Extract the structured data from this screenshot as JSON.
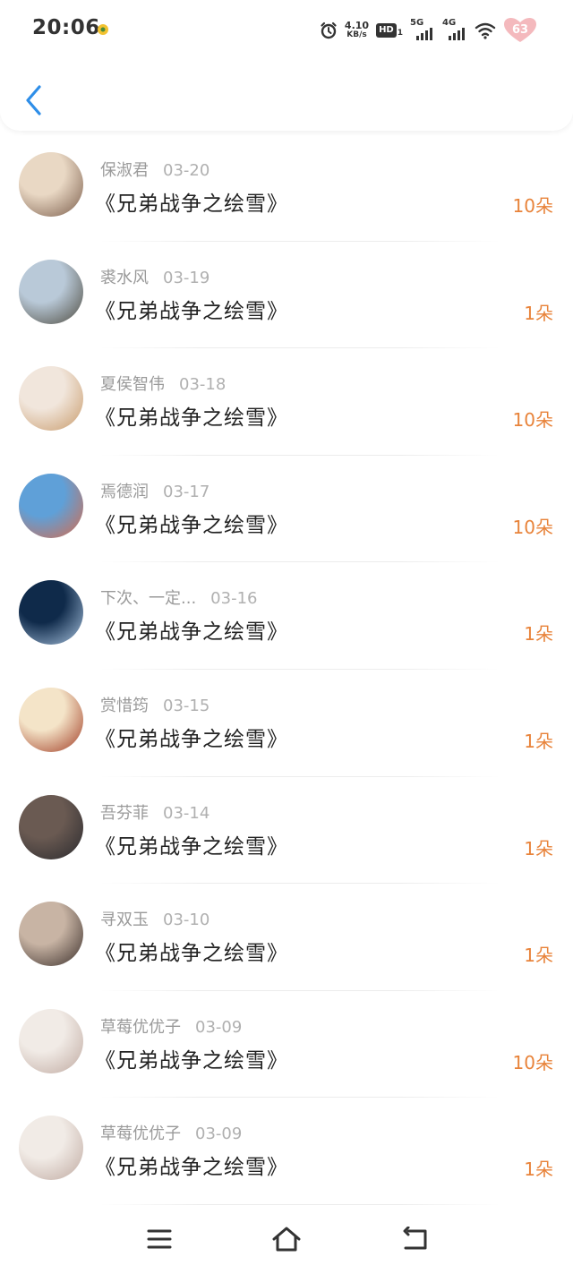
{
  "status_bar": {
    "time": "20:06",
    "speed_value": "4.10",
    "speed_unit": "KB/s",
    "hd_label": "HD",
    "hd_sub": "1",
    "net1_label": "5G",
    "net2_label": "4G",
    "battery": "63",
    "icons": [
      "notification-dot-icon",
      "alarm-icon",
      "hd-icon",
      "signal-icon",
      "wifi-icon",
      "battery-icon"
    ]
  },
  "header": {
    "back_icon": "chevron-left-icon"
  },
  "colors": {
    "accent_blue": "#2e8ee8",
    "count_orange": "#e8833a",
    "name_gray": "#9a9a9a",
    "title_dark": "#222222"
  },
  "gifts": [
    {
      "name": "保淑君",
      "date": "03-20",
      "title": "《兄弟战争之绘雪》",
      "count": "10朵",
      "avatar_colors": [
        "#e9d8c4",
        "#7a5c4a"
      ]
    },
    {
      "name": "裘水风",
      "date": "03-19",
      "title": "《兄弟战争之绘雪》",
      "count": "1朵",
      "avatar_colors": [
        "#b9c9d8",
        "#4d4a3e"
      ]
    },
    {
      "name": "夏侯智伟",
      "date": "03-18",
      "title": "《兄弟战争之绘雪》",
      "count": "10朵",
      "avatar_colors": [
        "#f1e6dc",
        "#c89a6a"
      ]
    },
    {
      "name": "焉德润",
      "date": "03-17",
      "title": "《兄弟战争之绘雪》",
      "count": "10朵",
      "avatar_colors": [
        "#5fa0d8",
        "#d86a4a"
      ]
    },
    {
      "name": "下次、一定...",
      "date": "03-16",
      "title": "《兄弟战争之绘雪》",
      "count": "1朵",
      "avatar_colors": [
        "#0f2a4a",
        "#a9c4e0"
      ]
    },
    {
      "name": "赏惜筠",
      "date": "03-15",
      "title": "《兄弟战争之绘雪》",
      "count": "1朵",
      "avatar_colors": [
        "#f4e4c8",
        "#a03a22"
      ]
    },
    {
      "name": "吾芬菲",
      "date": "03-14",
      "title": "《兄弟战争之绘雪》",
      "count": "1朵",
      "avatar_colors": [
        "#6a5a52",
        "#2a2a2e"
      ]
    },
    {
      "name": "寻双玉",
      "date": "03-10",
      "title": "《兄弟战争之绘雪》",
      "count": "1朵",
      "avatar_colors": [
        "#c8b4a4",
        "#3a2e2a"
      ]
    },
    {
      "name": "草莓优优子",
      "date": "03-09",
      "title": "《兄弟战争之绘雪》",
      "count": "10朵",
      "avatar_colors": [
        "#f1ebe6",
        "#bfa9a0"
      ]
    },
    {
      "name": "草莓优优子",
      "date": "03-09",
      "title": "《兄弟战争之绘雪》",
      "count": "1朵",
      "avatar_colors": [
        "#f1ebe6",
        "#bfa9a0"
      ]
    }
  ],
  "navbar": {
    "icons": [
      "menu-icon",
      "home-icon",
      "back-icon"
    ]
  }
}
